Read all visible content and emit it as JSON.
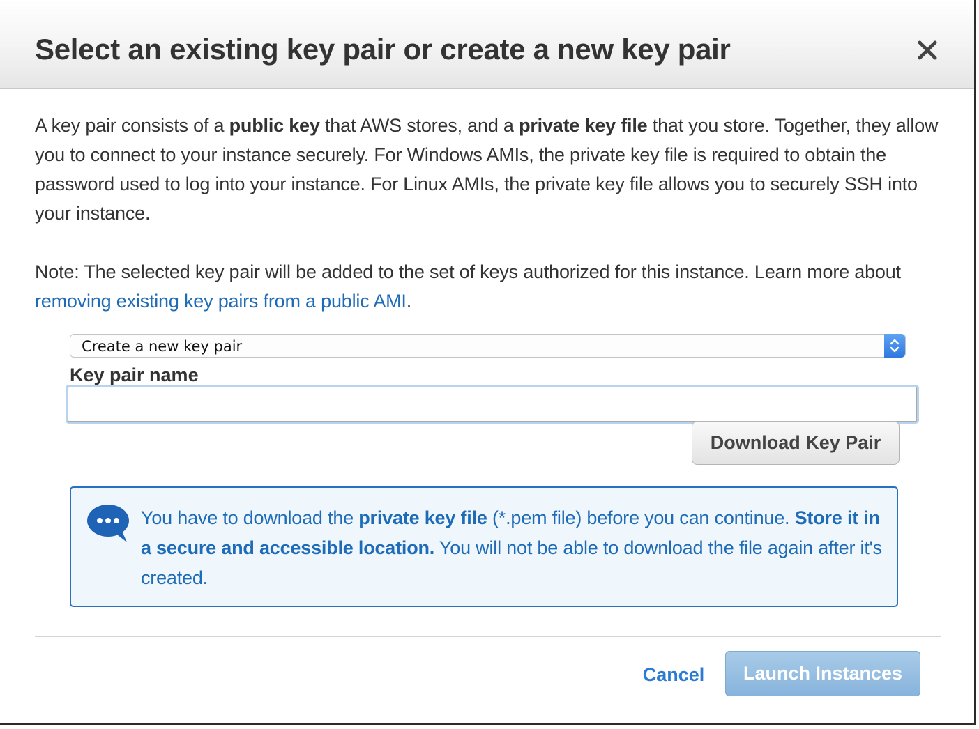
{
  "dialog": {
    "title": "Select an existing key pair or create a new key pair",
    "close_symbol": "×"
  },
  "intro": {
    "seg1": "A key pair consists of a ",
    "bold1": "public key",
    "seg2": " that AWS stores, and a ",
    "bold2": "private key file",
    "seg3": " that you store. Together, they allow you to connect to your instance securely. For Windows AMIs, the private key file is required to obtain the password used to log into your instance. For Linux AMIs, the private key file allows you to securely SSH into your instance."
  },
  "note": {
    "text": "Note: The selected key pair will be added to the set of keys authorized for this instance. Learn more about ",
    "link_text": "removing existing key pairs from a public AMI",
    "suffix": "."
  },
  "key_pair_select": {
    "selected": "Create a new key pair"
  },
  "key_pair_name": {
    "label": "Key pair name",
    "value": "",
    "placeholder": ""
  },
  "download_button": {
    "label": "Download Key Pair"
  },
  "info_box": {
    "icon": "speech-bubble-icon",
    "seg1": "You have to download the ",
    "bold1": "private key file",
    "seg2": " (*.pem file) before you can continue. ",
    "bold2": "Store it in a secure and accessible location.",
    "seg3": " You will not be able to download the file again after it's created."
  },
  "footer": {
    "cancel_label": "Cancel",
    "launch_label": "Launch Instances"
  },
  "colors": {
    "link": "#1e6bb8",
    "info_border": "#2a70c0",
    "info_bg": "#f0f7fc",
    "launch_bg": "#98bfe2",
    "select_arrow": "#3d86ea"
  }
}
